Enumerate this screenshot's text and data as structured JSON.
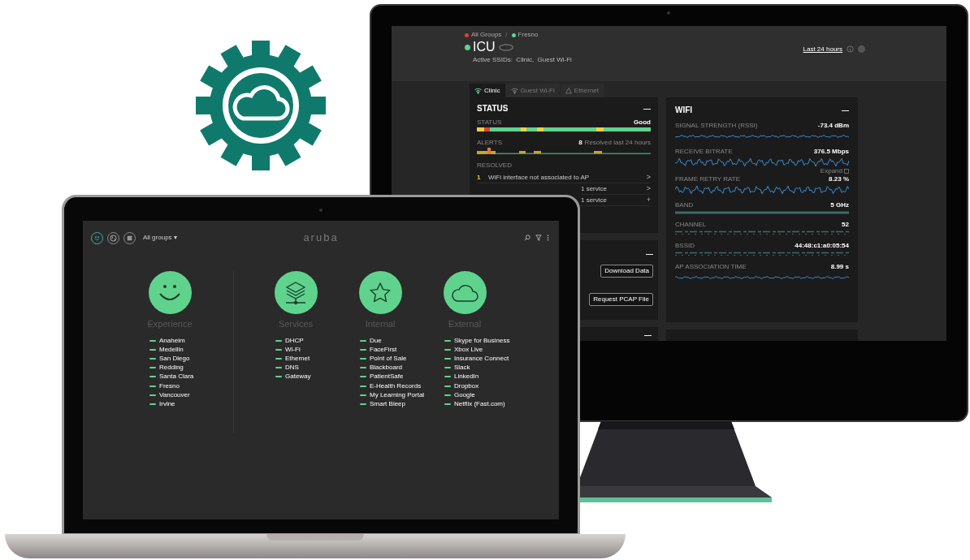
{
  "monitor": {
    "breadcrumb": [
      {
        "label": "All Groups",
        "color": "#e0403a"
      },
      {
        "label": "Fresno",
        "color": "#5fd38d"
      }
    ],
    "breadcrumb_separator": "/",
    "device": {
      "name": "ICU",
      "online": true,
      "ssids": "Active SSIDs:  Clinic,  Guest Wi-Fi"
    },
    "time_range": "Last 24 hours",
    "tabs": [
      {
        "label": "Clinic",
        "kind": "wifi",
        "selected": true
      },
      {
        "label": "Guest Wi-Fi",
        "kind": "wifi",
        "selected": false
      },
      {
        "label": "Ethernet",
        "kind": "ethernet",
        "selected": false
      }
    ],
    "status_card": {
      "title": "STATUS",
      "collapse": "—",
      "status_label": "STATUS",
      "status_value": "Good",
      "alerts_label": "ALERTS",
      "alerts_count": "8",
      "alerts_note": "Resolved last 24 hours",
      "resolved_label": "RESOLVED",
      "resolved": [
        {
          "count": "1",
          "text": "WiFi interface not associated to AP",
          "action": ">"
        },
        {
          "text": "1 service",
          "action": ">"
        },
        {
          "text": "1 service",
          "action": "+"
        }
      ]
    },
    "actions_card": {
      "collapse": "—",
      "buttons": [
        "Download Data",
        "Request PCAP File"
      ]
    },
    "bottom_card": {
      "collapse": "—"
    },
    "wifi_card": {
      "title": "WIFI",
      "collapse": "—",
      "expand": "Expand",
      "metrics": [
        {
          "label": "SIGNAL STRENGTH (RSSI)",
          "value": "-73.4 dBm",
          "kind": "flatwave"
        },
        {
          "label": "RECEIVE BITRATE",
          "value": "376.5 Mbps",
          "kind": "wave"
        },
        {
          "label": "FRAME RETRY RATE",
          "value": "8.23 %",
          "kind": "wave"
        },
        {
          "label": "BAND",
          "value": "5 GHz",
          "kind": "solid"
        },
        {
          "label": "CHANNEL",
          "value": "52",
          "kind": "dashed"
        },
        {
          "label": "BSSID",
          "value": "44:48:c1:a0:05:54",
          "kind": "dashed"
        },
        {
          "label": "AP ASSOCIATION TIME",
          "value": "8.99 s",
          "kind": "flatwave"
        }
      ]
    }
  },
  "laptop": {
    "nav_icons": [
      {
        "kind": "smiley",
        "selected": true
      },
      {
        "kind": "globe",
        "selected": false
      },
      {
        "kind": "grid",
        "selected": false
      }
    ],
    "group_menu": "All groups ▾",
    "logo": "aruba",
    "groups": [
      {
        "title": "Experience",
        "items": [
          "Anaheim",
          "Medellin",
          "San Diego",
          "Redding",
          "Santa Clara",
          "Fresno",
          "Vancouver",
          "Irvine"
        ]
      },
      {
        "title": "Services",
        "items": [
          "DHCP",
          "Wi-Fi",
          "Ethernet",
          "DNS",
          "Gateway"
        ]
      },
      {
        "title": "Internal",
        "items": [
          "Due",
          "FaceFirst",
          "Point of Sale",
          "Blackboard",
          "PatientSafe",
          "E-Health Records",
          "My Learning Portal",
          "Smart Bleep"
        ]
      },
      {
        "title": "External",
        "items": [
          "Skype for Business",
          "Xbox Live",
          "Insurance Connect",
          "Slack",
          "LinkedIn",
          "Dropbox",
          "Google",
          "Netflix (Fast.com)"
        ]
      }
    ]
  }
}
